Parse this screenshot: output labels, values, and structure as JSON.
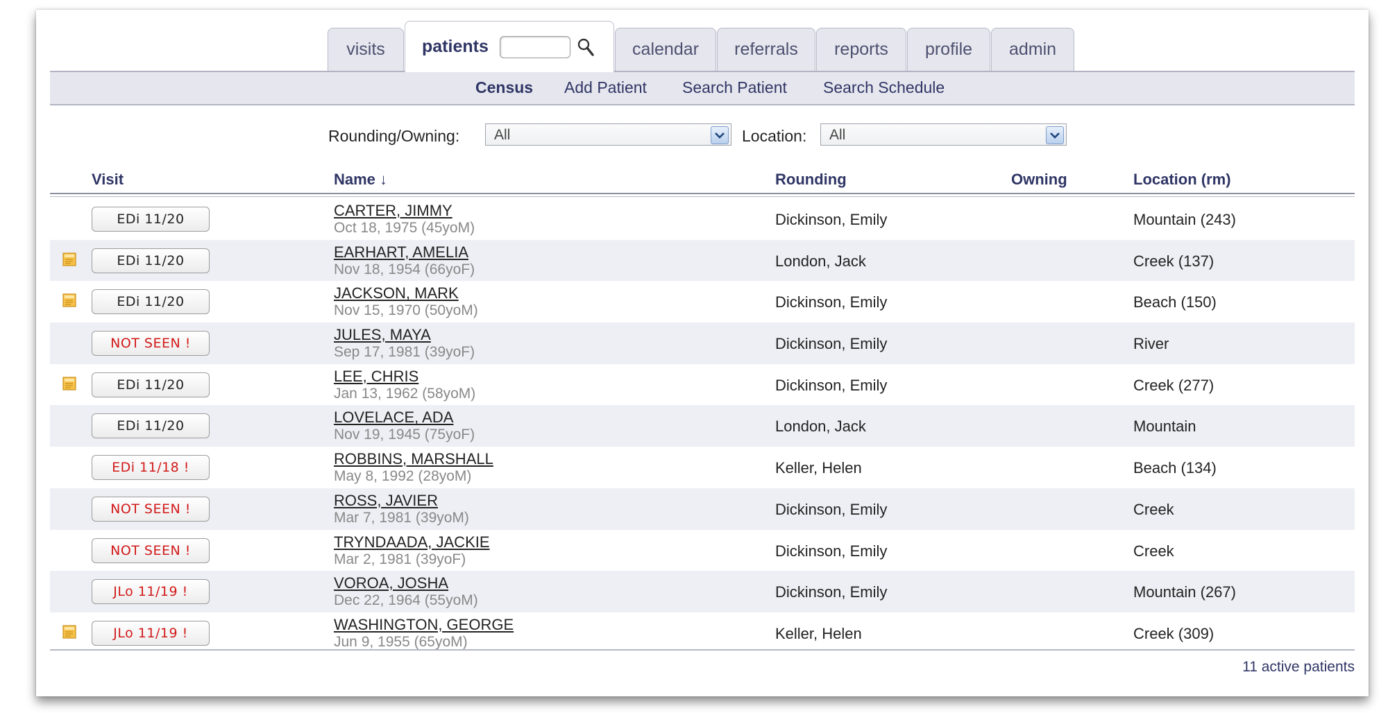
{
  "tabs": {
    "visits": "visits",
    "patients": "patients",
    "calendar": "calendar",
    "referrals": "referrals",
    "reports": "reports",
    "profile": "profile",
    "admin": "admin"
  },
  "subnav": {
    "census": "Census",
    "add_patient": "Add Patient",
    "search_patient": "Search Patient",
    "search_schedule": "Search Schedule"
  },
  "filters": {
    "rounding_label": "Rounding/Owning:",
    "rounding_value": "All",
    "location_label": "Location:",
    "location_value": "All"
  },
  "columns": {
    "visit": "Visit",
    "name": "Name ↓",
    "rounding": "Rounding",
    "owning": "Owning",
    "location": "Location (rm)"
  },
  "patients": [
    {
      "visit": "EDi 11/20",
      "warn": false,
      "note": false,
      "name": "CARTER, JIMMY",
      "dob": "Oct 18, 1975 (45yoM)",
      "rounding": "Dickinson, Emily",
      "owning": "",
      "location": "Mountain (243)"
    },
    {
      "visit": "EDi 11/20",
      "warn": false,
      "note": true,
      "name": "EARHART, AMELIA",
      "dob": "Nov 18, 1954 (66yoF)",
      "rounding": "London, Jack",
      "owning": "",
      "location": "Creek (137)"
    },
    {
      "visit": "EDi 11/20",
      "warn": false,
      "note": true,
      "name": "JACKSON, MARK",
      "dob": "Nov 15, 1970 (50yoM)",
      "rounding": "Dickinson, Emily",
      "owning": "",
      "location": "Beach (150)"
    },
    {
      "visit": "NOT SEEN !",
      "warn": true,
      "note": false,
      "name": "JULES, MAYA",
      "dob": "Sep 17, 1981 (39yoF)",
      "rounding": "Dickinson, Emily",
      "owning": "",
      "location": "River"
    },
    {
      "visit": "EDi 11/20",
      "warn": false,
      "note": true,
      "name": "LEE, CHRIS",
      "dob": "Jan 13, 1962 (58yoM)",
      "rounding": "Dickinson, Emily",
      "owning": "",
      "location": "Creek (277)"
    },
    {
      "visit": "EDi 11/20",
      "warn": false,
      "note": false,
      "name": "LOVELACE, ADA",
      "dob": "Nov 19, 1945 (75yoF)",
      "rounding": "London, Jack",
      "owning": "",
      "location": "Mountain"
    },
    {
      "visit": "EDi 11/18 !",
      "warn": true,
      "note": false,
      "name": "ROBBINS, MARSHALL",
      "dob": "May 8, 1992 (28yoM)",
      "rounding": "Keller, Helen",
      "owning": "",
      "location": "Beach (134)"
    },
    {
      "visit": "NOT SEEN !",
      "warn": true,
      "note": false,
      "name": "ROSS, JAVIER",
      "dob": "Mar 7, 1981 (39yoM)",
      "rounding": "Dickinson, Emily",
      "owning": "",
      "location": "Creek"
    },
    {
      "visit": "NOT SEEN !",
      "warn": true,
      "note": false,
      "name": "TRYNDAADA, JACKIE",
      "dob": "Mar 2, 1981 (39yoF)",
      "rounding": "Dickinson, Emily",
      "owning": "",
      "location": "Creek"
    },
    {
      "visit": "JLo 11/19 !",
      "warn": true,
      "note": false,
      "name": "VOROA, JOSHA",
      "dob": "Dec 22, 1964 (55yoM)",
      "rounding": "Dickinson, Emily",
      "owning": "",
      "location": "Mountain (267)"
    },
    {
      "visit": "JLo 11/19 !",
      "warn": true,
      "note": true,
      "name": "WASHINGTON, GEORGE",
      "dob": "Jun 9, 1955 (65yoM)",
      "rounding": "Keller, Helen",
      "owning": "",
      "location": "Creek (309)"
    }
  ],
  "footer": {
    "count": "11 active patients"
  },
  "colors": {
    "accent": "#2f3565",
    "warn": "#d21919",
    "row_alt": "#eeeff5",
    "tab_bg": "#e6e7ee"
  }
}
